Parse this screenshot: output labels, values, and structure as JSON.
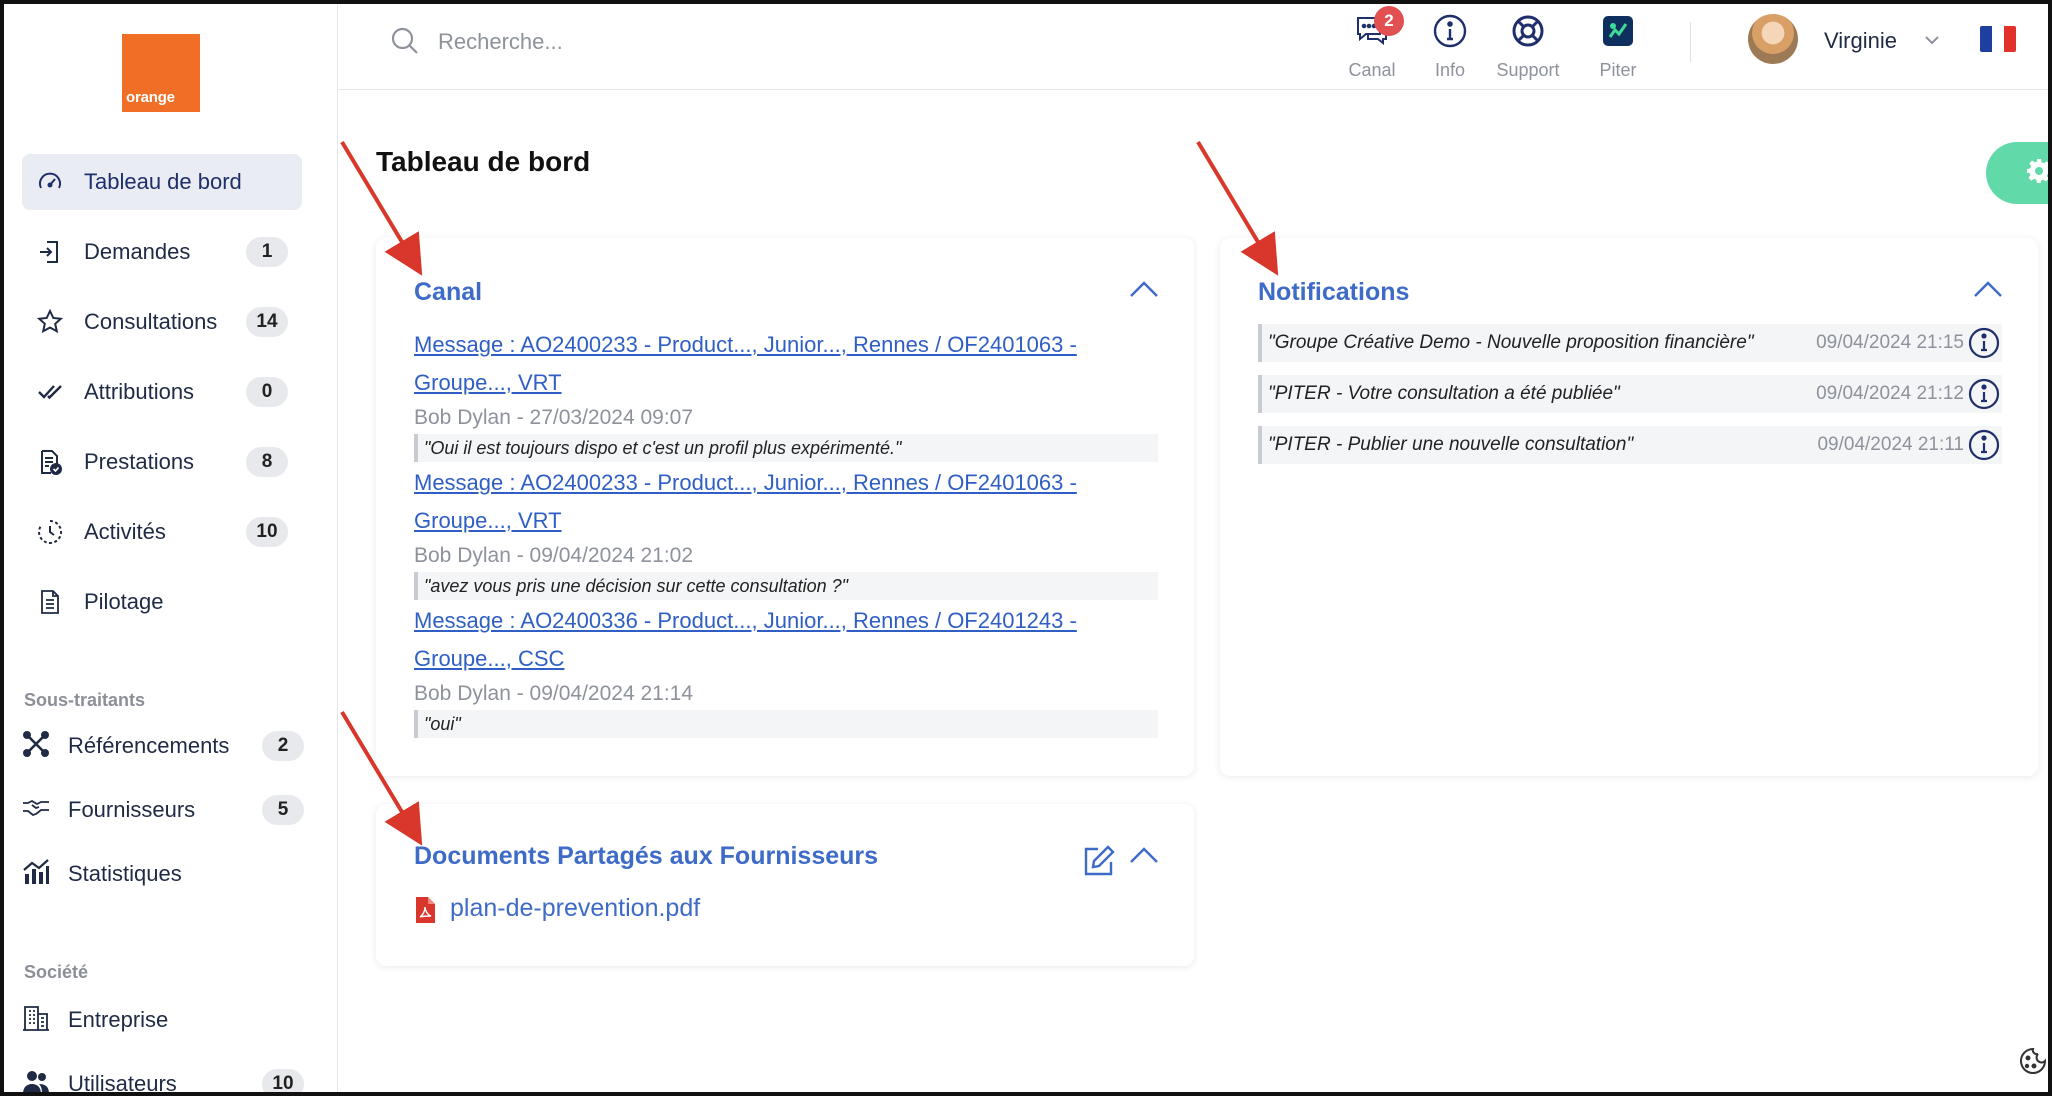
{
  "brand": {
    "logo_text": "orange",
    "logo_color": "#f16e26"
  },
  "sidebar": {
    "items": [
      {
        "label": "Tableau de bord",
        "icon": "gauge-icon",
        "badge": ""
      },
      {
        "label": "Demandes",
        "icon": "sign-in-icon",
        "badge": "1"
      },
      {
        "label": "Consultations",
        "icon": "star-icon",
        "badge": "14"
      },
      {
        "label": "Attributions",
        "icon": "double-check-icon",
        "badge": "0"
      },
      {
        "label": "Prestations",
        "icon": "document-check-icon",
        "badge": "8"
      },
      {
        "label": "Activités",
        "icon": "clock-history-icon",
        "badge": "10"
      },
      {
        "label": "Pilotage",
        "icon": "document-icon",
        "badge": ""
      }
    ],
    "section_soustraitants": "Sous-traitants",
    "subitems": [
      {
        "label": "Référencements",
        "icon": "network-icon",
        "badge": "2"
      },
      {
        "label": "Fournisseurs",
        "icon": "handshake-icon",
        "badge": "5"
      },
      {
        "label": "Statistiques",
        "icon": "chart-icon",
        "badge": ""
      }
    ],
    "section_societe": "Société",
    "societe_items": [
      {
        "label": "Entreprise",
        "icon": "building-icon",
        "badge": ""
      },
      {
        "label": "Utilisateurs",
        "icon": "users-icon",
        "badge": "10"
      }
    ]
  },
  "header": {
    "search_placeholder": "Recherche...",
    "buttons": [
      {
        "label": "Canal",
        "icon": "chat-icon",
        "badge": "2"
      },
      {
        "label": "Info",
        "icon": "info-icon"
      },
      {
        "label": "Support",
        "icon": "lifebuoy-icon"
      },
      {
        "label": "Piter",
        "icon": "piter-app-icon"
      }
    ],
    "user_name": "Virginie",
    "language_flag": "fr-flag-icon"
  },
  "main": {
    "title": "Tableau de bord",
    "canal": {
      "title": "Canal",
      "messages": [
        {
          "link_line1": "Message : AO2400233 - Product..., Junior..., Rennes / OF2401063 -",
          "link_line2": "Groupe..., VRT",
          "meta": "Bob Dylan - 27/03/2024 09:07",
          "quote": "\"Oui il est toujours dispo et c'est un profil plus expérimenté.\""
        },
        {
          "link_line1": "Message : AO2400233 - Product..., Junior..., Rennes / OF2401063 -",
          "link_line2": "Groupe..., VRT",
          "meta": "Bob Dylan - 09/04/2024 21:02",
          "quote": "\"avez vous pris une décision sur cette consultation ?\""
        },
        {
          "link_line1": "Message : AO2400336 - Product..., Junior..., Rennes / OF2401243 -",
          "link_line2": "Groupe..., CSC",
          "meta": "Bob Dylan - 09/04/2024 21:14",
          "quote": "\"oui\""
        }
      ]
    },
    "notifications": {
      "title": "Notifications",
      "rows": [
        {
          "text": "\"Groupe Créative Demo - Nouvelle proposition financière\"",
          "date": "09/04/2024 21:15"
        },
        {
          "text": "\"PITER - Votre consultation a été publiée\"",
          "date": "09/04/2024 21:12"
        },
        {
          "text": "\"PITER - Publier une nouvelle consultation\"",
          "date": "09/04/2024 21:11"
        }
      ]
    },
    "documents": {
      "title": "Documents Partagés aux Fournisseurs",
      "files": [
        {
          "name": "plan-de-prevention.pdf",
          "icon": "pdf-icon"
        }
      ]
    }
  },
  "colors": {
    "accent": "#3d6bc7",
    "link": "#2f5fc4",
    "badge_red": "#e25151",
    "gear_green": "#62d9a8",
    "annotation_arrow": "#d9372b"
  }
}
